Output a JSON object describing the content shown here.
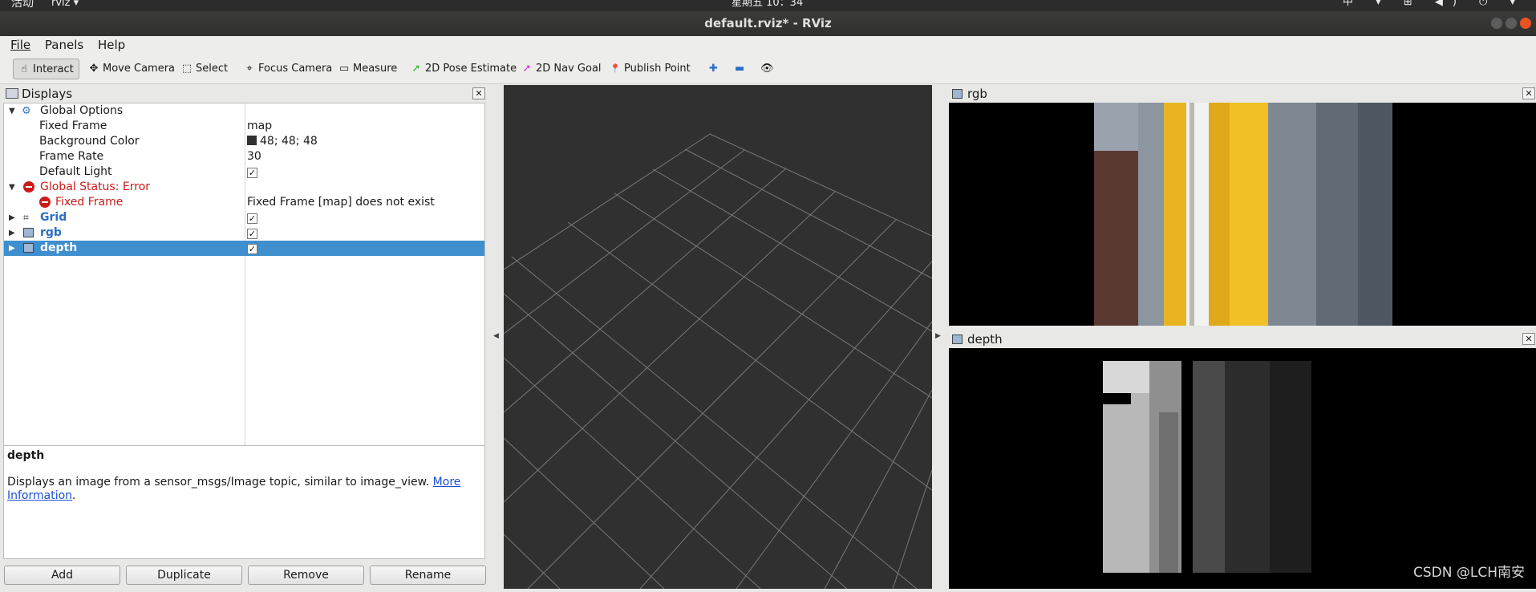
{
  "system_bar": {
    "activities": "活动",
    "app": "rviz ▾",
    "clock": "星期五 10：34",
    "tray": "中 ▾ ⊞ ◀) ⏻ ▾"
  },
  "window": {
    "title": "default.rviz* - RViz"
  },
  "menu": [
    "File",
    "Panels",
    "Help"
  ],
  "toolbar": [
    {
      "label": "Interact",
      "icon": "hand-icon",
      "glyph": "☝"
    },
    {
      "label": "Move Camera",
      "icon": "move-camera-icon",
      "glyph": "✥"
    },
    {
      "label": "Select",
      "icon": "select-icon",
      "glyph": "⬚"
    },
    {
      "label": "Focus Camera",
      "icon": "focus-icon",
      "glyph": "⌖"
    },
    {
      "label": "Measure",
      "icon": "ruler-icon",
      "glyph": "▭"
    },
    {
      "label": "2D Pose Estimate",
      "icon": "pose-arrow-icon",
      "glyph": "➚"
    },
    {
      "label": "2D Nav Goal",
      "icon": "nav-arrow-icon",
      "glyph": "➚"
    },
    {
      "label": "Publish Point",
      "icon": "map-pin-icon",
      "glyph": "📍"
    }
  ],
  "displays_panel": {
    "title": "Displays",
    "rows": [
      {
        "label": "Global Options",
        "value": ""
      },
      {
        "label": "Fixed Frame",
        "value": "map"
      },
      {
        "label": "Background Color",
        "value": "48; 48; 48"
      },
      {
        "label": "Frame Rate",
        "value": "30"
      },
      {
        "label": "Default Light",
        "value": "✓"
      },
      {
        "label": "Global Status: Error",
        "value": ""
      },
      {
        "label": "Fixed Frame",
        "value": "Fixed Frame [map] does not exist"
      },
      {
        "label": "Grid",
        "value": "✓"
      },
      {
        "label": "rgb",
        "value": "✓"
      },
      {
        "label": "depth",
        "value": "✓"
      }
    ],
    "description_title": "depth",
    "description_text": "Displays an image from a sensor_msgs/Image topic, similar to image_view.",
    "description_link": "More Information",
    "description_end": ".",
    "buttons": [
      "Add",
      "Duplicate",
      "Remove",
      "Rename"
    ]
  },
  "rgb_panel": {
    "title": "rgb"
  },
  "depth_panel": {
    "title": "depth"
  },
  "watermark": "CSDN @LCH南安",
  "colors": {
    "background": "#303030",
    "selection": "#3f8ecd",
    "error": "#cc1b1b",
    "link": "#1a4fd6"
  }
}
